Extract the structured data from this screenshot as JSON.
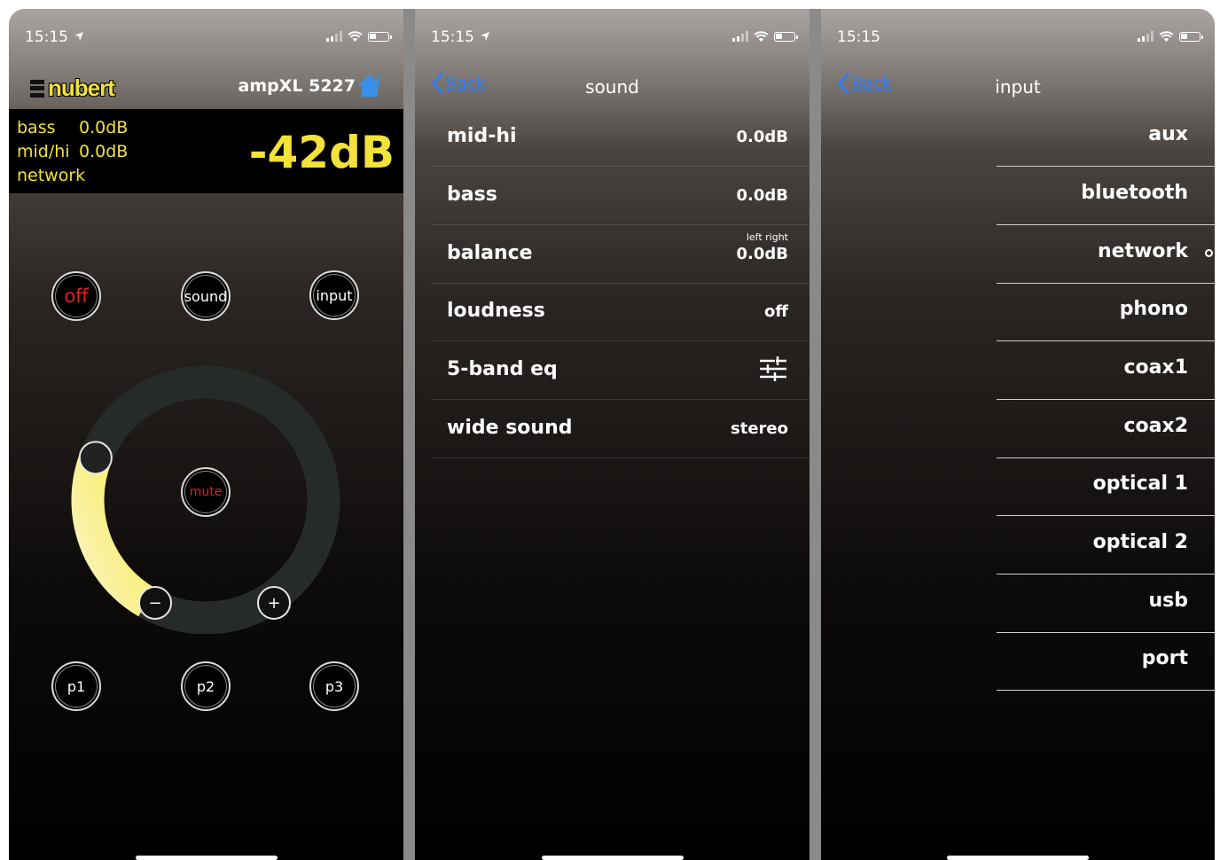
{
  "colors": {
    "accent_yellow": "#f2e23a",
    "link_blue": "#2f7cf6",
    "off_red": "#e02020"
  },
  "main": {
    "status": {
      "time": "15:15",
      "location_icon": "location-arrow-icon"
    },
    "logo": "nubert",
    "device_name": "ampXL 5227",
    "info": {
      "bass_label": "bass",
      "bass_value": "0.0dB",
      "midhi_label": "mid/hi",
      "midhi_value": "0.0dB",
      "source": "network",
      "volume": "-42dB"
    },
    "buttons": {
      "off": "off",
      "sound": "sound",
      "input": "input",
      "mute": "mute",
      "minus": "−",
      "plus": "+"
    },
    "volume_level": 0.27,
    "presets": [
      "p1",
      "p2",
      "p3"
    ]
  },
  "sound": {
    "status": {
      "time": "15:15"
    },
    "back_label": "Back",
    "title": "sound",
    "rows": [
      {
        "label": "mid-hi",
        "value": "0.0dB"
      },
      {
        "label": "bass",
        "value": "0.0dB"
      },
      {
        "label": "balance",
        "value": "0.0dB",
        "sub": "left right"
      },
      {
        "label": "loudness",
        "value": "off"
      },
      {
        "label": "5-band eq",
        "icon": "sliders-icon"
      },
      {
        "label": "wide sound",
        "value": "stereo"
      }
    ]
  },
  "input": {
    "status": {
      "time": "15:15"
    },
    "back_label": "Back",
    "title": "input",
    "items": [
      "aux",
      "bluetooth",
      "network",
      "phono",
      "coax1",
      "coax2",
      "optical 1",
      "optical 2",
      "usb",
      "port"
    ],
    "selected": "network"
  }
}
